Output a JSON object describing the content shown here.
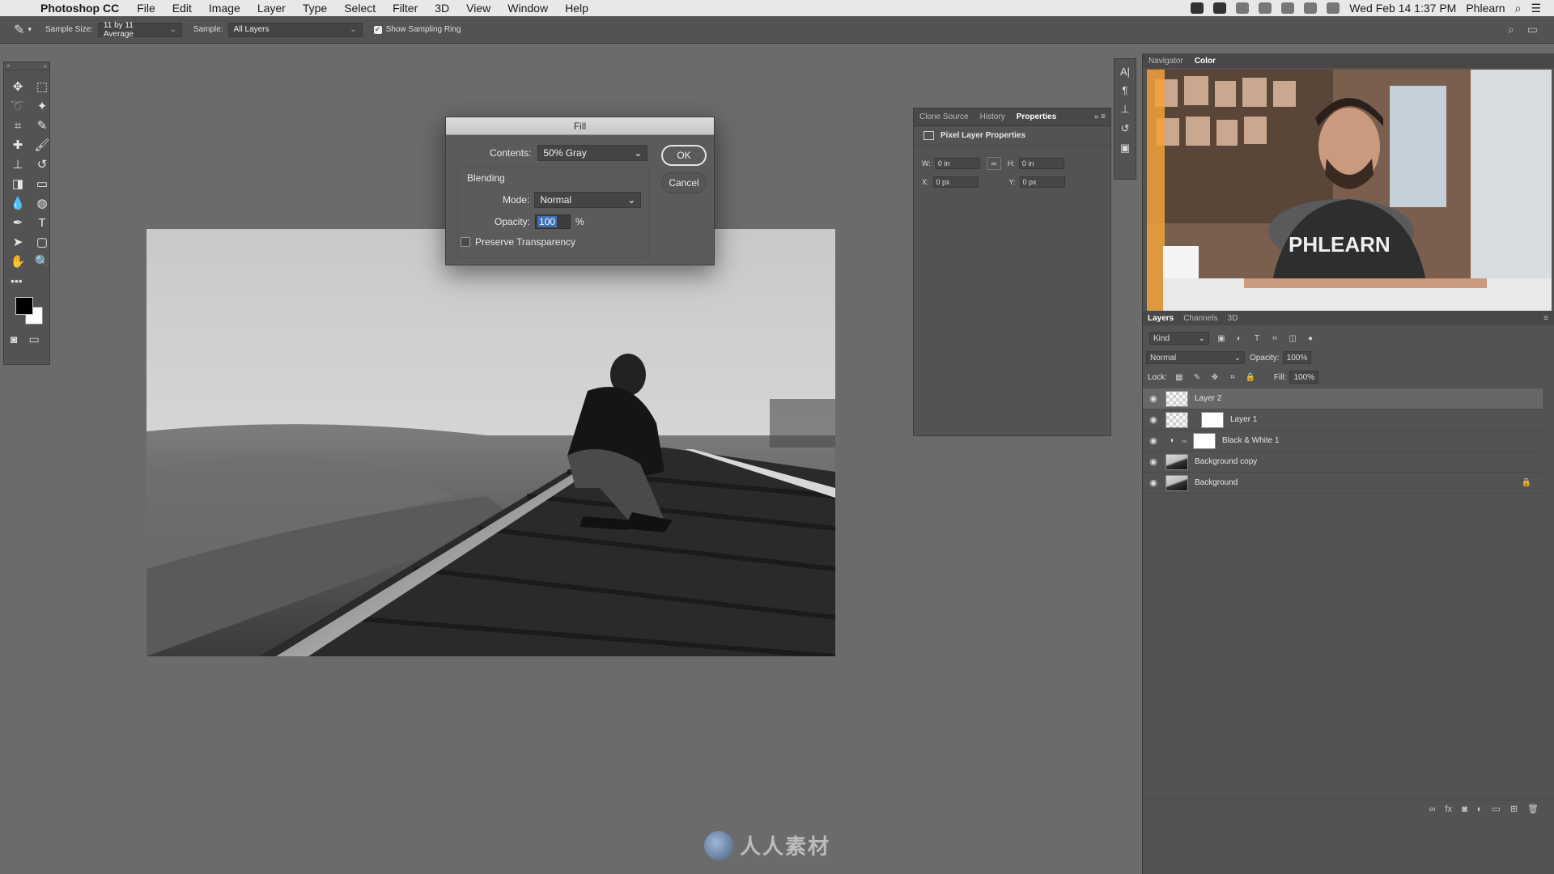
{
  "menubar": {
    "app_name": "Photoshop CC",
    "items": [
      "File",
      "Edit",
      "Image",
      "Layer",
      "Type",
      "Select",
      "Filter",
      "3D",
      "View",
      "Window",
      "Help"
    ],
    "clock": "Wed Feb 14  1:37 PM",
    "user": "Phlearn"
  },
  "options": {
    "sample_size_label": "Sample Size:",
    "sample_size_value": "11 by 11 Average",
    "sample_label": "Sample:",
    "sample_value": "All Layers",
    "show_ring_label": "Show Sampling Ring"
  },
  "fill_dialog": {
    "title": "Fill",
    "contents_label": "Contents:",
    "contents_value": "50% Gray",
    "ok_label": "OK",
    "cancel_label": "Cancel",
    "blending_label": "Blending",
    "mode_label": "Mode:",
    "mode_value": "Normal",
    "opacity_label": "Opacity:",
    "opacity_value": "100",
    "percent": "%",
    "preserve_label": "Preserve Transparency"
  },
  "properties": {
    "tabs": [
      "Clone Source",
      "History",
      "Properties"
    ],
    "title": "Pixel Layer Properties",
    "w_label": "W:",
    "w_value": "0 in",
    "h_label": "H:",
    "h_value": "0 in",
    "x_label": "X:",
    "x_value": "0 px",
    "y_label": "Y:",
    "y_value": "0 px"
  },
  "navigator": {
    "tabs": [
      "Navigator",
      "Color"
    ]
  },
  "webcam": {
    "shirt_text": "PHLEARN"
  },
  "layers_panel": {
    "tabs": [
      "Layers",
      "Channels",
      "3D"
    ],
    "kind_label": "Kind",
    "blend_mode": "Normal",
    "opacity_label": "Opacity:",
    "opacity_value": "100%",
    "lock_label": "Lock:",
    "fill_label": "Fill:",
    "fill_value": "100%",
    "layers": [
      {
        "name": "Layer 2"
      },
      {
        "name": "Layer 1"
      },
      {
        "name": "Black & White 1"
      },
      {
        "name": "Background copy"
      },
      {
        "name": "Background"
      }
    ]
  },
  "watermark": {
    "text": "人人素材"
  },
  "colors": {
    "workspace": "#6b6b6b",
    "panel": "#535353",
    "selection_highlight": "#3d6fb8"
  }
}
